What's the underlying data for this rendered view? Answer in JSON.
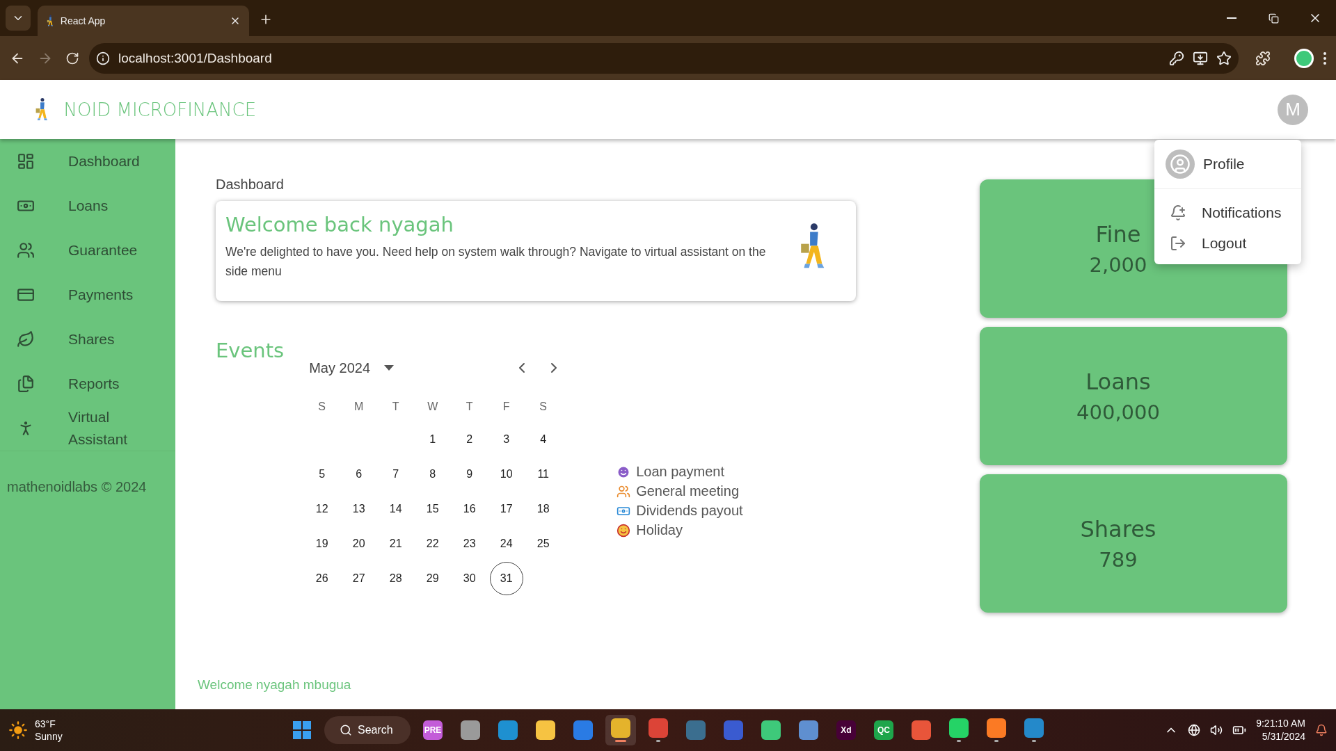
{
  "browser": {
    "tab_title": "React App",
    "url": "localhost:3001/Dashboard"
  },
  "header": {
    "brand": "NOID MICROFINANCE",
    "avatar": "M"
  },
  "sidebar": {
    "items": [
      {
        "kind": "dashboard",
        "label": "Dashboard",
        "selected": false
      },
      {
        "kind": "loans",
        "label": "Loans",
        "selected": false
      },
      {
        "kind": "guarantee",
        "label": "Guarantee",
        "selected": false
      },
      {
        "kind": "payments",
        "label": "Payments",
        "selected": false
      },
      {
        "kind": "shares",
        "label": "Shares",
        "selected": false
      },
      {
        "kind": "reports",
        "label": "Reports",
        "selected": false
      },
      {
        "kind": "assistant",
        "label": "Virtual Assistant",
        "selected": false
      }
    ],
    "footer": "mathenoidlabs © 2024"
  },
  "main": {
    "breadcrumb": "Dashboard",
    "welcome": {
      "title": "Welcome back nyagah",
      "text": "We're delighted to have you. Need help on system walk through? Navigate to virtual assistant on the side menu"
    },
    "events": {
      "title": "Events",
      "month": "May 2024",
      "weekdays": [
        "S",
        "M",
        "T",
        "W",
        "T",
        "F",
        "S"
      ],
      "weeks": [
        {
          "days": [
            {
              "kind": "blank"
            },
            {
              "kind": "blank"
            },
            {
              "kind": "blank"
            },
            {
              "kind": "day",
              "label": "1",
              "today": false
            },
            {
              "kind": "day",
              "label": "2",
              "today": false
            },
            {
              "kind": "day",
              "label": "3",
              "today": false
            },
            {
              "kind": "day",
              "label": "4",
              "today": false
            }
          ]
        },
        {
          "days": [
            {
              "kind": "day",
              "label": "5",
              "today": false
            },
            {
              "kind": "day",
              "label": "6",
              "today": false
            },
            {
              "kind": "day",
              "label": "7",
              "today": false
            },
            {
              "kind": "day",
              "label": "8",
              "today": false
            },
            {
              "kind": "day",
              "label": "9",
              "today": false
            },
            {
              "kind": "day",
              "label": "10",
              "today": false
            },
            {
              "kind": "day",
              "label": "11",
              "today": false
            }
          ]
        },
        {
          "days": [
            {
              "kind": "day",
              "label": "12",
              "today": false
            },
            {
              "kind": "day",
              "label": "13",
              "today": false
            },
            {
              "kind": "day",
              "label": "14",
              "today": false
            },
            {
              "kind": "day",
              "label": "15",
              "today": false
            },
            {
              "kind": "day",
              "label": "16",
              "today": false
            },
            {
              "kind": "day",
              "label": "17",
              "today": false
            },
            {
              "kind": "day",
              "label": "18",
              "today": false
            }
          ]
        },
        {
          "days": [
            {
              "kind": "day",
              "label": "19",
              "today": false
            },
            {
              "kind": "day",
              "label": "20",
              "today": false
            },
            {
              "kind": "day",
              "label": "21",
              "today": false
            },
            {
              "kind": "day",
              "label": "22",
              "today": false
            },
            {
              "kind": "day",
              "label": "23",
              "today": false
            },
            {
              "kind": "day",
              "label": "24",
              "today": false
            },
            {
              "kind": "day",
              "label": "25",
              "today": false
            }
          ]
        },
        {
          "days": [
            {
              "kind": "day",
              "label": "26",
              "today": false
            },
            {
              "kind": "day",
              "label": "27",
              "today": false
            },
            {
              "kind": "day",
              "label": "28",
              "today": false
            },
            {
              "kind": "day",
              "label": "29",
              "today": false
            },
            {
              "kind": "day",
              "label": "30",
              "today": false
            },
            {
              "kind": "day",
              "label": "31",
              "today": true
            }
          ]
        }
      ],
      "legend": [
        {
          "kind": "loan",
          "label": "Loan payment"
        },
        {
          "kind": "meeting",
          "label": "General meeting"
        },
        {
          "kind": "dividends",
          "label": "Dividends payout"
        },
        {
          "kind": "holiday",
          "label": "Holiday"
        }
      ]
    },
    "footer": "Welcome nyagah mbugua"
  },
  "stats": [
    {
      "title": "Fine",
      "value": "2,000"
    },
    {
      "title": "Loans",
      "value": "400,000"
    },
    {
      "title": "Shares",
      "value": "789"
    }
  ],
  "user_menu": {
    "items": [
      {
        "kind": "profile",
        "label": "Profile"
      },
      {
        "kind": "notifications",
        "label": "Notifications"
      },
      {
        "kind": "logout",
        "label": "Logout"
      }
    ]
  },
  "taskbar": {
    "weather": {
      "temp": "63°F",
      "condition": "Sunny"
    },
    "search": "Search",
    "apps": [
      {
        "color": "#c35cd8",
        "label": "PRE",
        "running": false,
        "selected": false
      },
      {
        "color": "#9a9a9a",
        "running": false,
        "selected": false
      },
      {
        "color": "#1e90d0",
        "running": false,
        "selected": false
      },
      {
        "color": "#f6c342",
        "running": false,
        "selected": false
      },
      {
        "color": "#2a7be4",
        "running": false,
        "selected": false
      },
      {
        "color": "#e4b32c",
        "running": true,
        "selected": true
      },
      {
        "color": "#dc4437",
        "running": true,
        "selected": false
      },
      {
        "color": "#3b6e8f",
        "running": false,
        "selected": false
      },
      {
        "color": "#3a5bd0",
        "running": false,
        "selected": false
      },
      {
        "color": "#3ec97a",
        "running": false,
        "selected": false
      },
      {
        "color": "#5f8fd0",
        "running": false,
        "selected": false
      },
      {
        "color": "#470137",
        "label": "Xd",
        "running": false,
        "selected": false
      },
      {
        "color": "#1ea54b",
        "label": "QC",
        "running": false,
        "selected": false
      },
      {
        "color": "#e8553a",
        "running": false,
        "selected": false
      },
      {
        "color": "#25d366",
        "running": true,
        "selected": false
      },
      {
        "color": "#fb7a24",
        "running": true,
        "selected": false
      },
      {
        "color": "#2489ca",
        "running": true,
        "selected": false
      }
    ],
    "time": "9:21:10 AM",
    "date": "5/31/2024"
  }
}
